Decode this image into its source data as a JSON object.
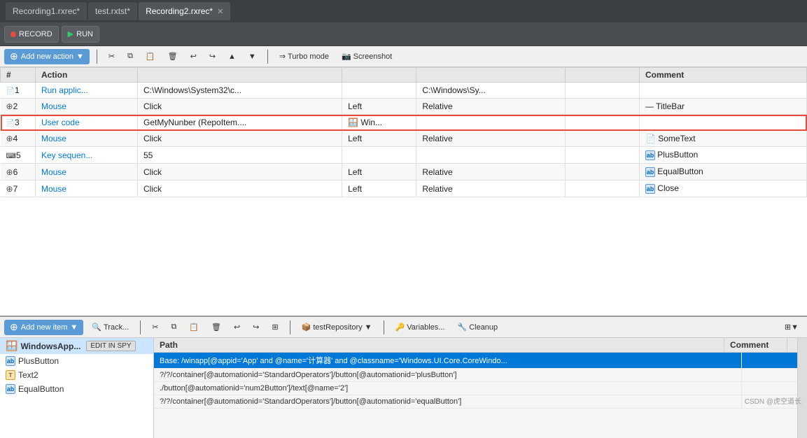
{
  "titleBar": {
    "tabs": [
      {
        "label": "Recording1.rxrec*",
        "active": false,
        "closable": false
      },
      {
        "label": "test.rxtst*",
        "active": false,
        "closable": false
      },
      {
        "label": "Recording2.rxrec*",
        "active": true,
        "closable": true
      }
    ]
  },
  "toolbar": {
    "recordBtn": "RECORD",
    "runBtn": "RUN"
  },
  "actionBar": {
    "addNewAction": "Add new action",
    "turboMode": "Turbo mode",
    "screenshot": "Screenshot"
  },
  "tableHeaders": {
    "num": "#",
    "action": "Action",
    "param1": "",
    "param2": "",
    "param3": "",
    "param4": "",
    "comment": "Comment"
  },
  "tableRows": [
    {
      "num": "1",
      "expand": false,
      "action": "Run applic...",
      "p1": "C:\\Windows\\System32\\c...",
      "p2": "",
      "p3": "C:\\Windows\\Sy...",
      "p4": "",
      "comment": "",
      "highlighted": false,
      "icon": "page"
    },
    {
      "num": "2",
      "expand": true,
      "action": "Mouse",
      "p1": "Click",
      "p2": "Left",
      "p3": "Relative",
      "p4": "",
      "comment": "— TitleBar",
      "highlighted": false,
      "icon": "plus"
    },
    {
      "num": "3",
      "expand": false,
      "action": "User code",
      "p1": "GetMyNunber (RepoItem....",
      "p2": "🪟 Win...",
      "p2icon": true,
      "p3": "",
      "p4": "",
      "comment": "",
      "highlighted": true,
      "icon": "page"
    },
    {
      "num": "4",
      "expand": true,
      "action": "Mouse",
      "p1": "Click",
      "p2": "Left",
      "p3": "Relative",
      "p4": "",
      "comment": "📄 SomeText",
      "highlighted": false,
      "icon": "plus"
    },
    {
      "num": "5",
      "expand": false,
      "action": "Key sequen...",
      "p1": "55",
      "p2": "",
      "p3": "",
      "p4": "",
      "comment": "ab PlusButton",
      "highlighted": false,
      "icon": "kbd"
    },
    {
      "num": "6",
      "expand": true,
      "action": "Mouse",
      "p1": "Click",
      "p2": "Left",
      "p3": "Relative",
      "p4": "",
      "comment": "ab EqualButton",
      "highlighted": false,
      "icon": "plus"
    },
    {
      "num": "7",
      "expand": true,
      "action": "Mouse",
      "p1": "Click",
      "p2": "Left",
      "p3": "Relative",
      "p4": "",
      "comment": "ab Close",
      "highlighted": false,
      "icon": "plus"
    }
  ],
  "bottomToolbar": {
    "addNewItem": "Add new item",
    "track": "Track...",
    "testRepository": "testRepository",
    "variables": "Variables...",
    "cleanup": "Cleanup"
  },
  "bottomPanel": {
    "leftItems": [
      {
        "label": "WindowsApp...",
        "active": true,
        "icon": "windows"
      },
      {
        "label": "PlusButton",
        "icon": "ab"
      },
      {
        "label": "Text2",
        "icon": "text"
      },
      {
        "label": "EqualButton",
        "icon": "ab"
      }
    ],
    "editInSpy": "EDIT IN SPY",
    "pathHeader": "Path",
    "commentHeader": "Comment",
    "pathRows": [
      {
        "path": "Base: /winapp[@appid='App' and @name='计算器' and @classname='Windows.UI.Core.CoreWindo...",
        "comment": "",
        "selected": true
      },
      {
        "path": "?/?/container[@automationid='StandardOperators']/button[@automationid='plusButton']",
        "comment": "",
        "selected": false
      },
      {
        "path": "./button[@automationid='num2Button']/text[@name='2']",
        "comment": "",
        "selected": false
      },
      {
        "path": "?/?/container[@automationid='StandardOperators']/button[@automationid='equalButton']",
        "comment": "",
        "selected": false
      }
    ]
  },
  "watermark": "CSDN @虎空道长"
}
